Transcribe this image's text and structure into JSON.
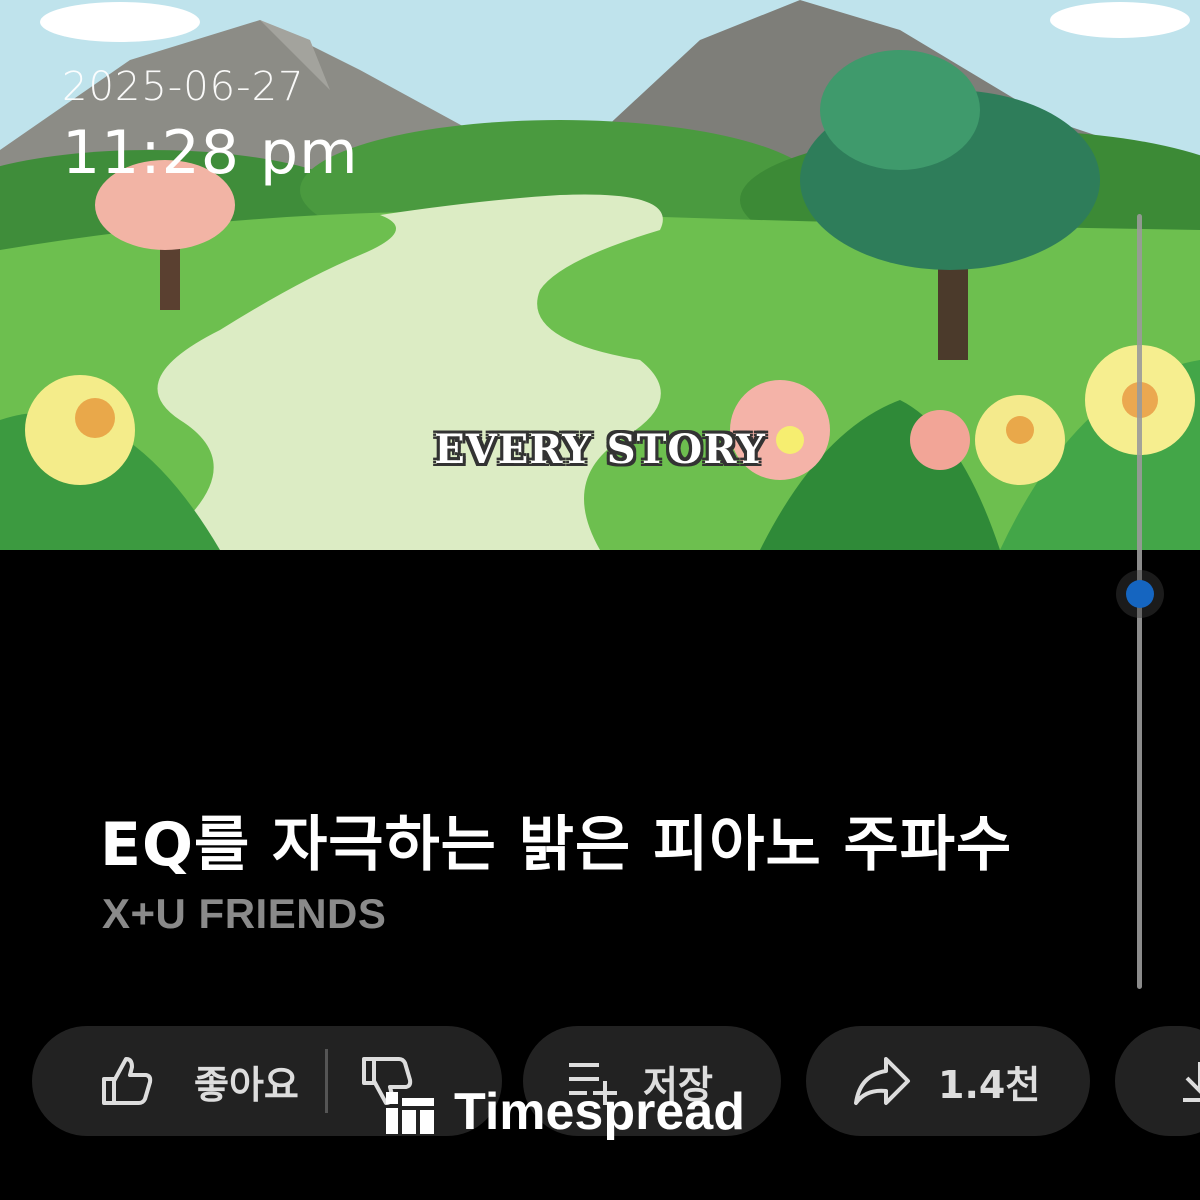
{
  "overlay": {
    "date": "2025-06-27",
    "time": "11:28 pm"
  },
  "thumbnail": {
    "caption": "EVERY STORY"
  },
  "video": {
    "title": "EQ를 자극하는 밝은 피아노 주파수",
    "channel": "X+U FRIENDS"
  },
  "actions": {
    "like_label": "좋아요",
    "save_label": "저장",
    "share_count": "1.4천"
  },
  "watermark": {
    "brand": "Timespread"
  },
  "scroll": {
    "position_fraction": 0.49
  },
  "colors": {
    "background": "#000000",
    "pill": "#222222",
    "scroll_thumb": "#1565c0",
    "channel_text": "#8a8a8a"
  }
}
